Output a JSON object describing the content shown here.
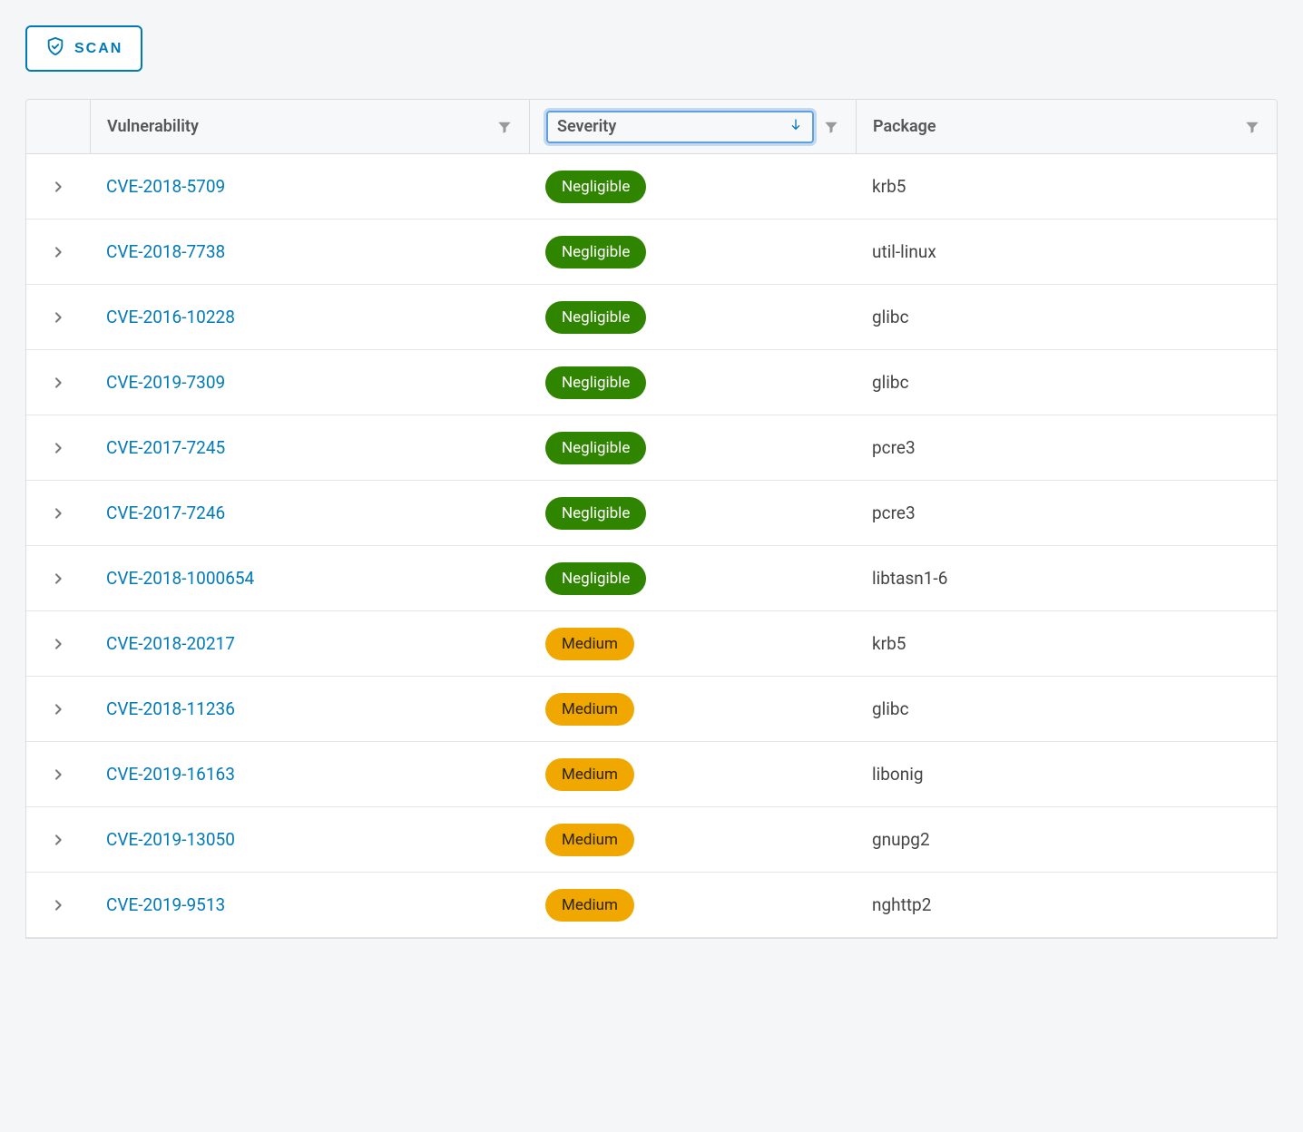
{
  "toolbar": {
    "scan_label": "SCAN"
  },
  "columns": {
    "vulnerability": "Vulnerability",
    "severity": "Severity",
    "package": "Package"
  },
  "severity_labels": {
    "negligible": "Negligible",
    "medium": "Medium"
  },
  "rows": [
    {
      "cve": "CVE-2018-5709",
      "severity": "negligible",
      "package": "krb5"
    },
    {
      "cve": "CVE-2018-7738",
      "severity": "negligible",
      "package": "util-linux"
    },
    {
      "cve": "CVE-2016-10228",
      "severity": "negligible",
      "package": "glibc"
    },
    {
      "cve": "CVE-2019-7309",
      "severity": "negligible",
      "package": "glibc"
    },
    {
      "cve": "CVE-2017-7245",
      "severity": "negligible",
      "package": "pcre3"
    },
    {
      "cve": "CVE-2017-7246",
      "severity": "negligible",
      "package": "pcre3"
    },
    {
      "cve": "CVE-2018-1000654",
      "severity": "negligible",
      "package": "libtasn1-6"
    },
    {
      "cve": "CVE-2018-20217",
      "severity": "medium",
      "package": "krb5"
    },
    {
      "cve": "CVE-2018-11236",
      "severity": "medium",
      "package": "glibc"
    },
    {
      "cve": "CVE-2019-16163",
      "severity": "medium",
      "package": "libonig"
    },
    {
      "cve": "CVE-2019-13050",
      "severity": "medium",
      "package": "gnupg2"
    },
    {
      "cve": "CVE-2019-9513",
      "severity": "medium",
      "package": "nghttp2"
    }
  ]
}
